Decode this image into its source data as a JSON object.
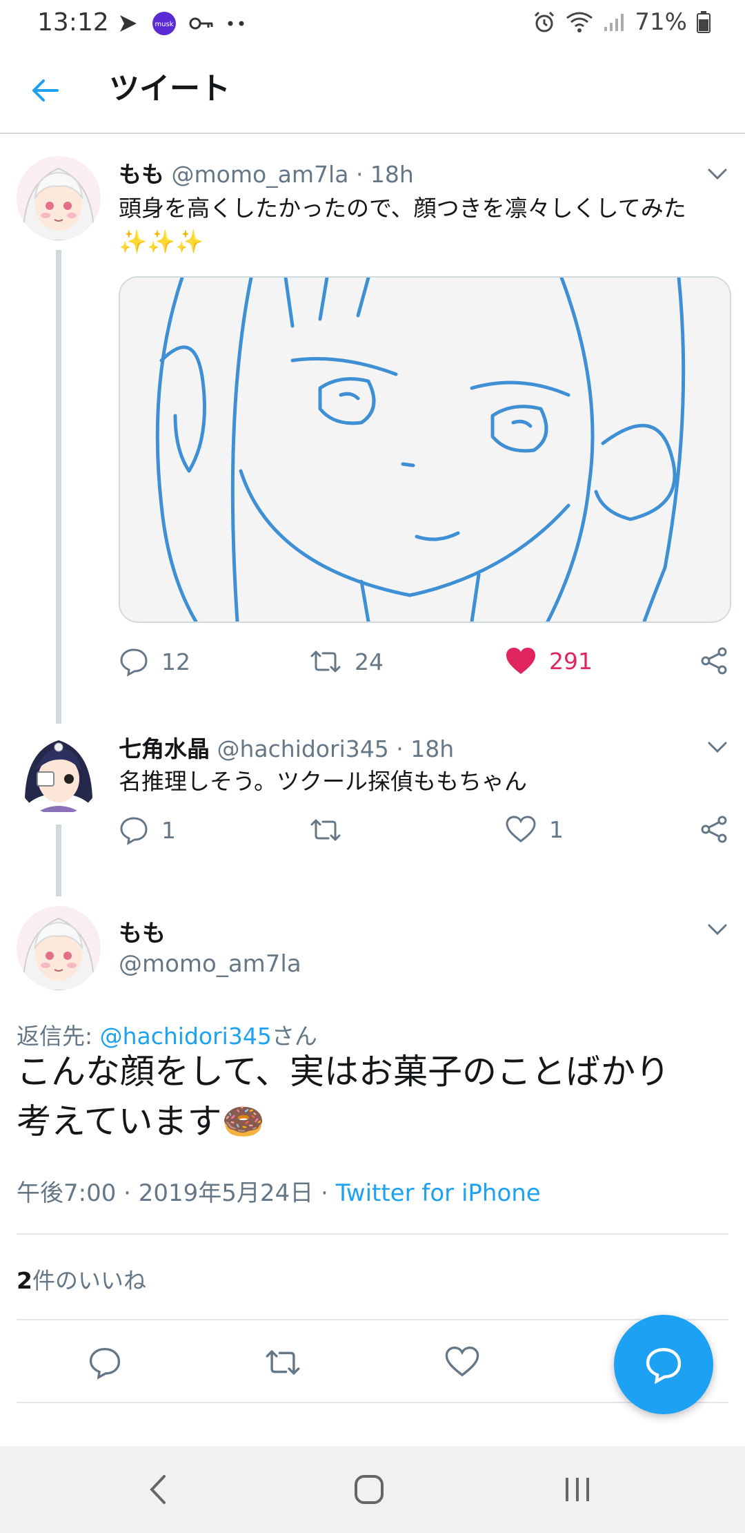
{
  "status_bar": {
    "time": "13:12",
    "battery": "71%"
  },
  "header": {
    "title": "ツイート"
  },
  "tweet1": {
    "name": "もも",
    "handle": "@momo_am7la",
    "time": "· 18h",
    "text_line1": "頭身を高くしたかったので、顔つきを凛々しくしてみた",
    "text_line2": "✨✨✨",
    "replies": "12",
    "retweets": "24",
    "likes": "291"
  },
  "tweet2": {
    "name": "七角水晶",
    "handle": "@hachidori345",
    "time": "· 18h",
    "text": "名推理しそう。ツクール探偵ももちゃん",
    "replies": "1",
    "retweets": "",
    "likes": "1"
  },
  "main_tweet": {
    "name": "もも",
    "handle": "@momo_am7la",
    "reply_label": "返信先: ",
    "reply_to": "@hachidori345",
    "reply_suffix": "さん",
    "text_line1": "こんな顔をして、実はお菓子のことばかり",
    "text_line2": "考えています🍩",
    "datetime": "午後7:00 · 2019年5月24日 · ",
    "source": "Twitter for iPhone",
    "likes_count": "2",
    "likes_label": "件のいいね"
  },
  "colors": {
    "accent": "#1da1f2",
    "like": "#e0245e",
    "muted": "#657786",
    "line": "#cfd9de"
  }
}
